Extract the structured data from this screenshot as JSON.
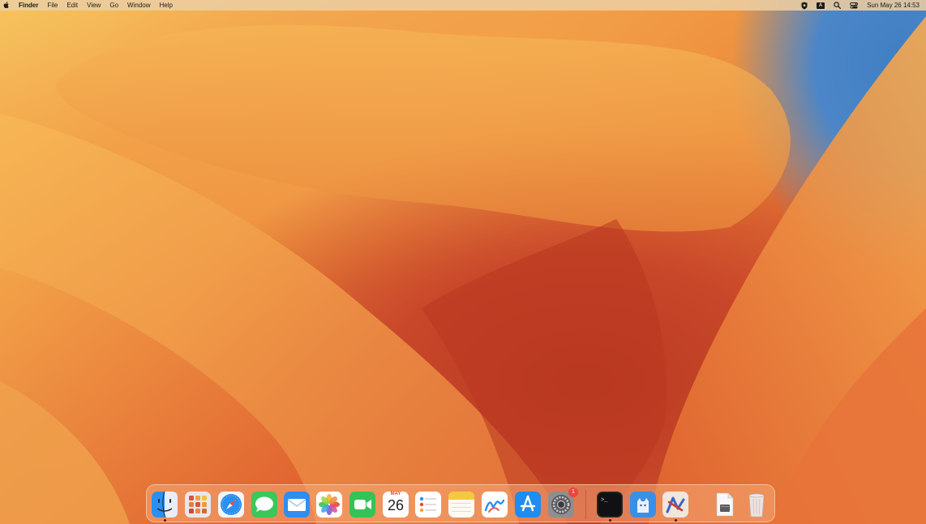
{
  "menubar": {
    "app_name": "Finder",
    "menus": [
      "File",
      "Edit",
      "View",
      "Go",
      "Window",
      "Help"
    ],
    "status_icons": [
      "vpn-shield-icon",
      "input-source-icon",
      "spotlight-search-icon",
      "control-center-icon"
    ],
    "input_source_label": "A",
    "clock": "Sun May 26  14:53"
  },
  "dock": {
    "apps": [
      {
        "name": "Finder",
        "icon": "finder-icon",
        "running": true
      },
      {
        "name": "Launchpad",
        "icon": "launchpad-icon",
        "running": false
      },
      {
        "name": "Safari",
        "icon": "safari-icon",
        "running": false
      },
      {
        "name": "Messages",
        "icon": "messages-icon",
        "running": false
      },
      {
        "name": "Mail",
        "icon": "mail-icon",
        "running": false
      },
      {
        "name": "Photos",
        "icon": "photos-icon",
        "running": false
      },
      {
        "name": "FaceTime",
        "icon": "facetime-icon",
        "running": false
      },
      {
        "name": "Calendar",
        "icon": "calendar-icon",
        "running": false,
        "month": "MAY",
        "day": "26"
      },
      {
        "name": "Reminders",
        "icon": "reminders-icon",
        "running": false
      },
      {
        "name": "Notes",
        "icon": "notes-icon",
        "running": false
      },
      {
        "name": "Freeform",
        "icon": "freeform-icon",
        "running": false
      },
      {
        "name": "App Store",
        "icon": "app-store-icon",
        "running": false
      },
      {
        "name": "System Settings",
        "icon": "system-settings-icon",
        "running": false,
        "badge": "1"
      },
      {
        "name": "Terminal",
        "icon": "terminal-icon",
        "running": true,
        "prompt": ">_"
      },
      {
        "name": "Cyberduck",
        "icon": "cat-app-icon",
        "running": false
      },
      {
        "name": "TextMate",
        "icon": "textmate-icon",
        "running": true
      },
      {
        "name": "Downloads",
        "icon": "document-stack-icon",
        "running": false
      },
      {
        "name": "Trash",
        "icon": "trash-icon",
        "running": false
      }
    ]
  },
  "colors": {
    "accent_red": "#e8473c",
    "wallpaper_orange": "#ec8a3a",
    "wallpaper_blue": "#4c86c8"
  }
}
